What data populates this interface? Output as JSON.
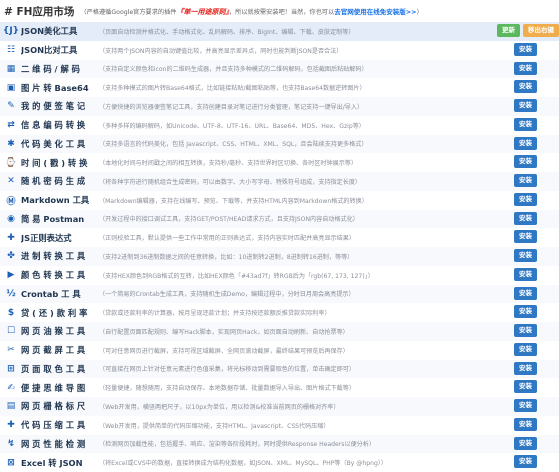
{
  "header": {
    "title": "# FH应用市场",
    "note_before": "（严格遵循Google官方要求的插件",
    "note_red": "『单一用途原则』",
    "note_after": "，所以就按需安装吧！当然，你也可以",
    "link": "去官网使用在线免安装版>>",
    "note_end": "）"
  },
  "labels": {
    "install": "安装",
    "update": "更新",
    "remove": "移出右键"
  },
  "tools": [
    {
      "icon": "{J}",
      "icon_name": "json-braces-icon",
      "name": "JSON美化工具",
      "desc": "（页面自动检测并格式化、手动格式化、乱码解码、排序、BigInt、编辑、下载、皮肤定制等）",
      "active": true
    },
    {
      "icon": "☷",
      "icon_name": "json-compare-icon",
      "name": "JSON比对工具",
      "desc": "（支持两个JSON内容的自动键值比较，并高亮显示差异点，同时也能判断JSON是否合法）"
    },
    {
      "icon": "▦",
      "icon_name": "qrcode-icon",
      "name": "二 维 码 / 解 码",
      "desc": "（支持自定义颜色和icon的二维码生成器，并且支持多种模式的二维码解码，包括截图后粘贴解码）"
    },
    {
      "icon": "▣",
      "icon_name": "image-icon",
      "name": "图 片 转 Base64",
      "desc": "（支持多种模式的图片转Base64格式，比如链接粘贴/截图粘贴等，也支持Base64数据逆转图片）"
    },
    {
      "icon": "✎",
      "icon_name": "pencil-icon",
      "name": "我 的 便 签 笔 记",
      "desc": "（方便快捷的浏览器便签笔记工具，支持创建目录对笔记进行分类管理，笔记支持一键导出/导入）"
    },
    {
      "icon": "⇄",
      "icon_name": "encode-icon",
      "name": "信 息 编 码 转 换",
      "desc": "（多种多样的编码解码，如Unicode、UTF-8、UTF-16、URL、Base64、MD5、Hex、Gzip等）"
    },
    {
      "icon": "✱",
      "icon_name": "code-format-icon",
      "name": "代 码 美 化 工 具",
      "desc": "（支持多语言的代码美化，包括 Javascript、CSS、HTML、XML、SQL，且会陆续支持更多格式）"
    },
    {
      "icon": "⌚",
      "icon_name": "clock-icon",
      "name": "时 间 ( 戳 ) 转 换",
      "desc": "（本地化时间与时间戳之间的相互转换，支持秒/毫秒、支持世界时区切换、各时区时钟展示等）"
    },
    {
      "icon": "✕",
      "icon_name": "random-password-icon",
      "name": "随 机 密 码 生 成",
      "desc": "（将各种字符进行随机组合生成密码，可以由数字、大小写字母、特殊符号组成，支持指定长度）"
    },
    {
      "icon": "Ⓜ",
      "icon_name": "markdown-icon",
      "name": "Markdown 工具",
      "desc": "（Markdown编辑器，支持在线编写、预览、下载等，并支持HTML内容到Markdown格式的转换）"
    },
    {
      "icon": "◉",
      "icon_name": "postman-icon",
      "name": "简 易 Postman",
      "desc": "（开发过程中的接口调试工具，支持GET/POST/HEAD请求方式，且支持JSON内容自动格式化）"
    },
    {
      "icon": "✚",
      "icon_name": "regex-icon",
      "name": "JS正则表达式",
      "desc": "（正则校验工具，默认提供一些工作中常用的正则表达式，支持内容实时匹配并高亮显示结果）"
    },
    {
      "icon": "✤",
      "icon_name": "radix-icon",
      "name": "进 制 转 换 工 具",
      "desc": "（支持2进制到36进制数据之间的任意转换，比如：10进制转2进制，8进制转16进制，等等）"
    },
    {
      "icon": "▶",
      "icon_name": "color-icon",
      "name": "颜 色 转 换 工 具",
      "desc": "（支持HEX颜色到RGB格式的互转，比如HEX颜色「#43ad7f」转RGB后为「rgb(67, 173, 127)」）"
    },
    {
      "icon": "½",
      "icon_name": "crontab-icon",
      "name": "Crontab 工 具",
      "desc": "（一个简易的Crontab生成工具，支持随机生成Demo，编辑过程中，分时日月周会高亮提示）"
    },
    {
      "icon": "$",
      "icon_name": "loan-icon",
      "name": "贷 ( 还 ) 款 利 率",
      "desc": "（贷款或还款利率的计算器，按月呈现还款计划；并支持按还款额反推贷款实际利率）"
    },
    {
      "icon": "☐",
      "icon_name": "web-hack-icon",
      "name": "网 页 油 猴 工 具",
      "desc": "（自行配置页面匹配规则、编写Hack脚本，实现网页Hack，如页面自动刷新、自动抢票等）"
    },
    {
      "icon": "✂",
      "icon_name": "screenshot-icon",
      "name": "网 页 截 屏 工 具",
      "desc": "（可对任意网页进行截屏，支持可视区域截屏、全网页滚动截屏，最终结果可预览后再保存）"
    },
    {
      "icon": "⊞",
      "icon_name": "color-picker-icon",
      "name": "页 面 取 色 工 具",
      "desc": "（可直接在网页上针对任意元素进行色值采集，将光标移动到需要取色的位置，单击确定即可）"
    },
    {
      "icon": "✍",
      "icon_name": "sticky-note-icon",
      "name": "便 捷 思 维 导 图",
      "desc": "（轻量便捷，随想随用，支持自动保存、本地数据存储、批量数据导入导出、图片格式下载等）"
    },
    {
      "icon": "▤",
      "icon_name": "ruler-icon",
      "name": "网 页 栅 格 标 尺",
      "desc": "（Web开发用，横竖两把尺子，以10px为单位，用以检测&校准当前网页的栅格对齐率）"
    },
    {
      "icon": "✚",
      "icon_name": "compress-icon",
      "name": "代 码 压 缩 工 具",
      "desc": "（Web开发用，提供简单的代码压缩功能，支持HTML、Javascript、CSS代码压缩）"
    },
    {
      "icon": "↯",
      "icon_name": "performance-icon",
      "name": "网 页 性 能 检 测",
      "desc": "（检测网页加载性能，包括握手、响应、渲染等各阶段耗时，同时提供Response Headers以便分析）"
    },
    {
      "icon": "⊠",
      "icon_name": "excel-icon",
      "name": "Excel 转 JSON",
      "desc": "（将Excel或CVS中的数据，直接转换成为结构化数据，如JSON、XML、MySQL、PHP等（By @hpng））"
    }
  ]
}
